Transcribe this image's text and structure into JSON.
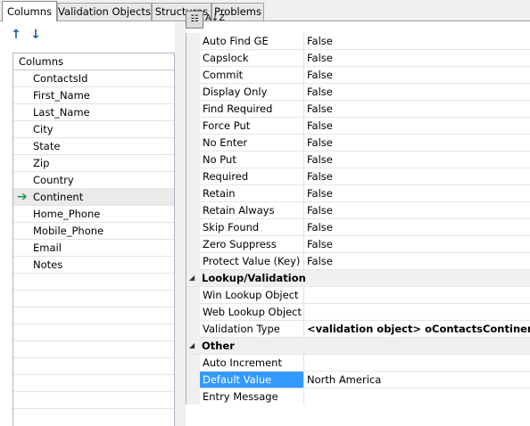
{
  "tabs": [
    {
      "label": "Columns",
      "active": true
    },
    {
      "label": "Validation Objects",
      "active": false
    },
    {
      "label": "Structures",
      "active": false
    },
    {
      "label": "Problems",
      "active": false
    }
  ],
  "toolbar": {
    "move_up_icon": "↑",
    "move_down_icon": "↓"
  },
  "columns_list": {
    "header": "Columns",
    "items": [
      "ContactsId",
      "First_Name",
      "Last_Name",
      "City",
      "State",
      "Zip",
      "Country",
      "Continent",
      "Home_Phone",
      "Mobile_Phone",
      "Email",
      "Notes"
    ],
    "current_item": "Continent"
  },
  "property_toolbar": {
    "categorized_icon": "☷",
    "alphabetical_icon": "A↓Z"
  },
  "properties": {
    "general_rows": [
      {
        "name": "Auto Find GE",
        "value": "False"
      },
      {
        "name": "Capslock",
        "value": "False"
      },
      {
        "name": "Commit",
        "value": "False"
      },
      {
        "name": "Display Only",
        "value": "False"
      },
      {
        "name": "Find Required",
        "value": "False"
      },
      {
        "name": "Force Put",
        "value": "False"
      },
      {
        "name": "No Enter",
        "value": "False"
      },
      {
        "name": "No Put",
        "value": "False"
      },
      {
        "name": "Required",
        "value": "False"
      },
      {
        "name": "Retain",
        "value": "False"
      },
      {
        "name": "Retain Always",
        "value": "False"
      },
      {
        "name": "Skip Found",
        "value": "False"
      },
      {
        "name": "Zero Suppress",
        "value": "False"
      },
      {
        "name": "Protect Value (Key)",
        "value": "False"
      }
    ],
    "lookup_category": "Lookup/Validation",
    "lookup_rows": [
      {
        "name": "Win Lookup Object",
        "value": ""
      },
      {
        "name": "Web Lookup Object",
        "value": ""
      },
      {
        "name": "Validation Type",
        "value": "<validation object> oContactsContinentVT"
      }
    ],
    "other_category": "Other",
    "other_rows": [
      {
        "name": "Auto Increment",
        "value": ""
      },
      {
        "name": "Default Value",
        "value": "North America"
      },
      {
        "name": "Entry Message",
        "value": ""
      }
    ],
    "selected_property": "Default Value"
  },
  "colors": {
    "selection": "#3399ff",
    "current_row_arrow": "#2a9a4a",
    "arrow_icons": "#1f5fb0"
  }
}
